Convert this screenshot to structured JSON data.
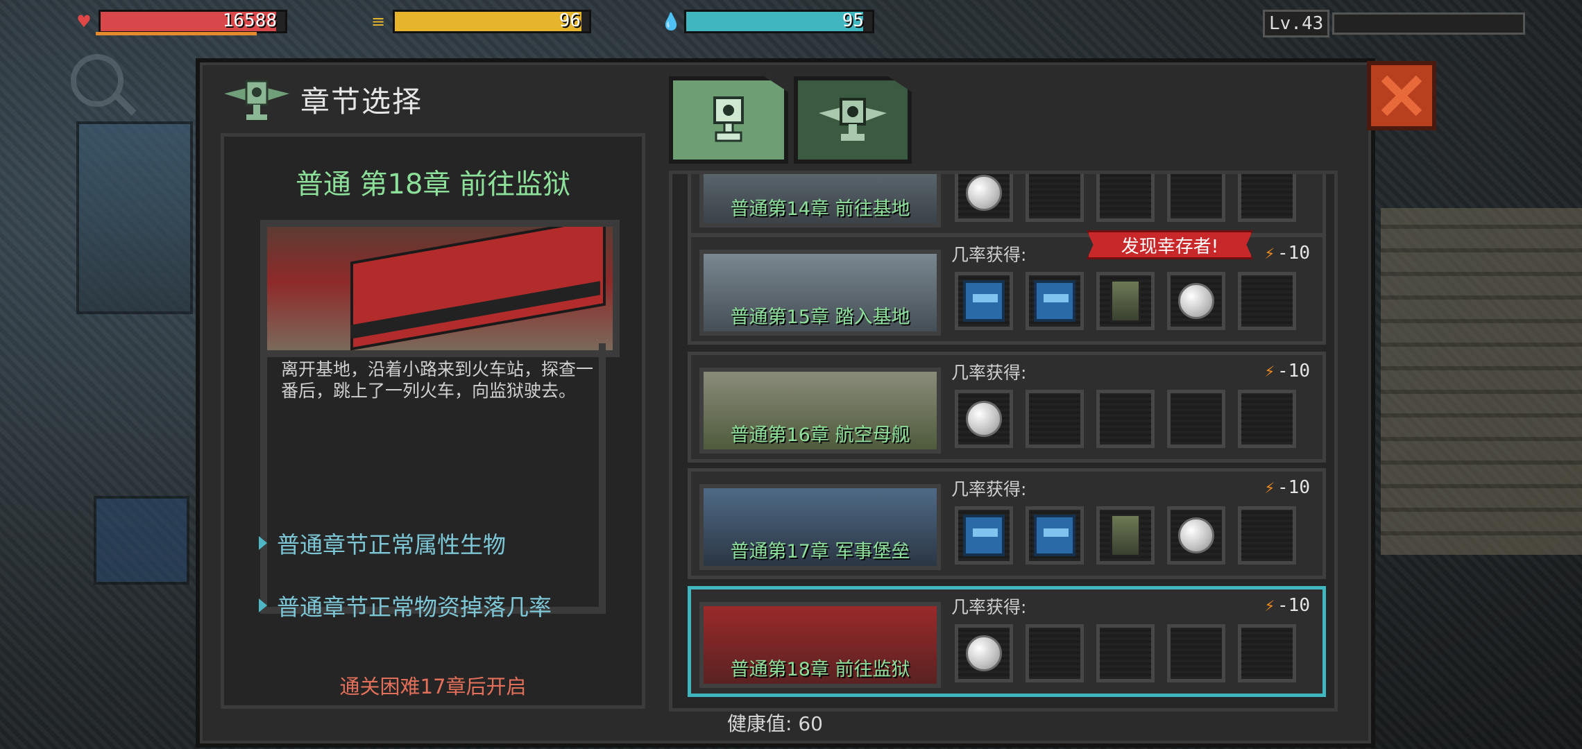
{
  "status": {
    "hp": {
      "value": "16588",
      "fill": 0.95,
      "color": "#d8484a"
    },
    "food": {
      "value": "96",
      "fill": 0.96,
      "color": "#e6b52b"
    },
    "water": {
      "value": "95",
      "fill": 0.95,
      "color": "#3fb6c0"
    },
    "level": {
      "label": "Lv.43",
      "xp_fill": 0.0
    }
  },
  "panel": {
    "title": "章节选择",
    "icons": {
      "emblem": "winged-trophy-icon",
      "close": "close-x-icon"
    }
  },
  "tabs": [
    {
      "icon": "trophy-icon",
      "active": true
    },
    {
      "icon": "winged-trophy-icon",
      "active": false
    }
  ],
  "detail": {
    "title": "普通 第18章 前往监狱",
    "description": "离开基地，沿着小路来到火车站，探查一番后，跳上了一列火车，向监狱驶去。",
    "link1": "普通章节正常属性生物",
    "link2": "普通章节正常物资掉落几率",
    "unlock_hint": "通关困难17章后开启"
  },
  "chapters": [
    {
      "name": "普通第14章 前往基地",
      "prob_label": "",
      "energy": "",
      "items": [
        "coin",
        "empty",
        "empty",
        "empty",
        "empty"
      ],
      "ribbon": "",
      "selected": false
    },
    {
      "name": "普通第15章 踏入基地",
      "prob_label": "几率获得:",
      "energy": "-10",
      "items": [
        "gun-box",
        "gun-box",
        "scrap",
        "coin",
        "empty"
      ],
      "ribbon": "发现幸存者!",
      "selected": false
    },
    {
      "name": "普通第16章 航空母舰",
      "prob_label": "几率获得:",
      "energy": "-10",
      "items": [
        "coin",
        "empty",
        "empty",
        "empty",
        "empty"
      ],
      "ribbon": "",
      "selected": false
    },
    {
      "name": "普通第17章 军事堡垒",
      "prob_label": "几率获得:",
      "energy": "-10",
      "items": [
        "gun-box",
        "gun-box",
        "scrap",
        "coin",
        "empty"
      ],
      "ribbon": "",
      "selected": false
    },
    {
      "name": "普通第18章 前往监狱",
      "prob_label": "几率获得:",
      "energy": "-10",
      "items": [
        "coin",
        "empty",
        "empty",
        "empty",
        "empty"
      ],
      "ribbon": "",
      "selected": true
    }
  ],
  "footer": {
    "health_text": "健康值: 60"
  }
}
